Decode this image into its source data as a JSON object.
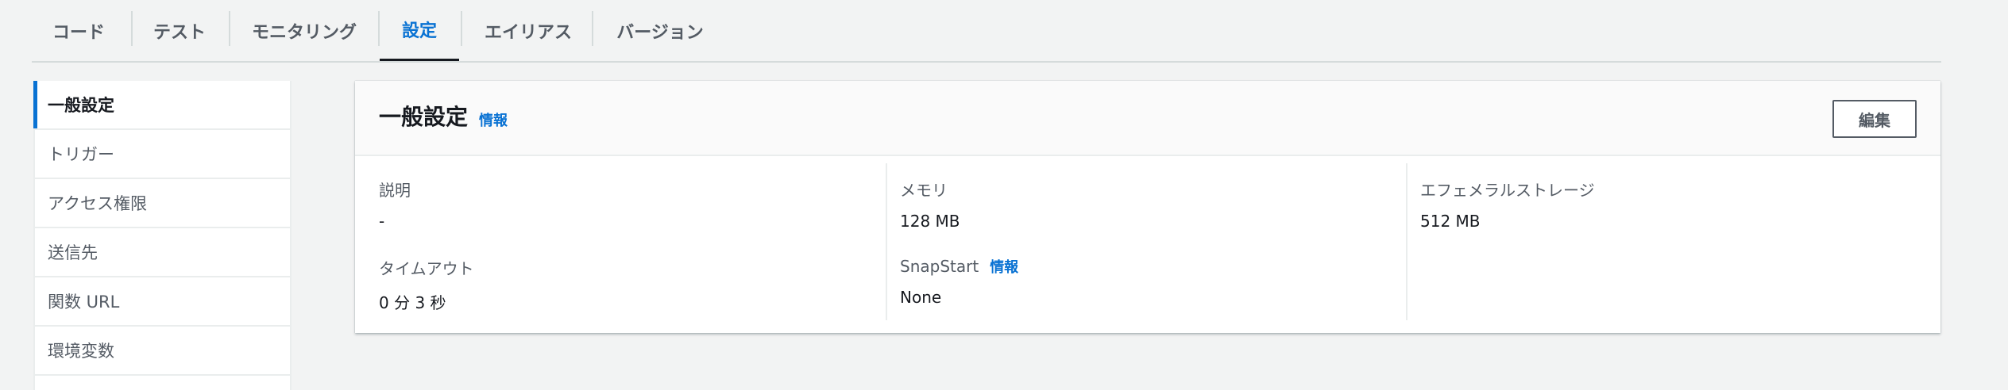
{
  "tabs": [
    {
      "label": "コード"
    },
    {
      "label": "テスト"
    },
    {
      "label": "モニタリング"
    },
    {
      "label": "設定"
    },
    {
      "label": "エイリアス"
    },
    {
      "label": "バージョン"
    }
  ],
  "sidebar": {
    "items": [
      {
        "label": "一般設定"
      },
      {
        "label": "トリガー"
      },
      {
        "label": "アクセス権限"
      },
      {
        "label": "送信先"
      },
      {
        "label": "関数 URL"
      },
      {
        "label": "環境変数"
      }
    ]
  },
  "panel": {
    "title": "一般設定",
    "info_label": "情報",
    "edit_label": "編集",
    "fields": {
      "description": {
        "label": "説明",
        "value": "-"
      },
      "memory": {
        "label": "メモリ",
        "value": "128  MB"
      },
      "ephemeral_storage": {
        "label": "エフェメラルストレージ",
        "value": "512  MB"
      },
      "timeout": {
        "label": "タイムアウト",
        "value": "0  分  3  秒"
      },
      "snapstart": {
        "label": "SnapStart",
        "info_label": "情報",
        "value": "None"
      }
    }
  },
  "colors": {
    "accent": "#0972d3",
    "background": "#f2f3f3",
    "text": "#16191f",
    "muted": "#545b64"
  }
}
